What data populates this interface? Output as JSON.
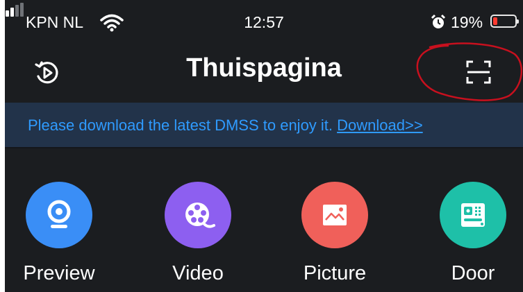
{
  "status_bar": {
    "carrier": "KPN NL",
    "time": "12:57",
    "battery_percent": "19%",
    "battery_level": 0.19
  },
  "header": {
    "title": "Thuispagina",
    "left_icon": "playback-history-icon",
    "right_icon": "scan-qr-icon"
  },
  "banner": {
    "message": "Please download the latest DMSS to enjoy it. ",
    "link": "Download>>"
  },
  "features": [
    {
      "label": "Preview",
      "icon": "camera-icon",
      "color": "#3a8ef6"
    },
    {
      "label": "Video",
      "icon": "film-reel-icon",
      "color": "#8d5ff0"
    },
    {
      "label": "Picture",
      "icon": "picture-icon",
      "color": "#f0605a"
    },
    {
      "label": "Door",
      "icon": "door-station-icon",
      "color": "#1ec0a8"
    }
  ],
  "colors": {
    "background": "#1b1d20",
    "banner_background": "#22334a",
    "link": "#2f9bff",
    "annotation": "#c8101e"
  }
}
